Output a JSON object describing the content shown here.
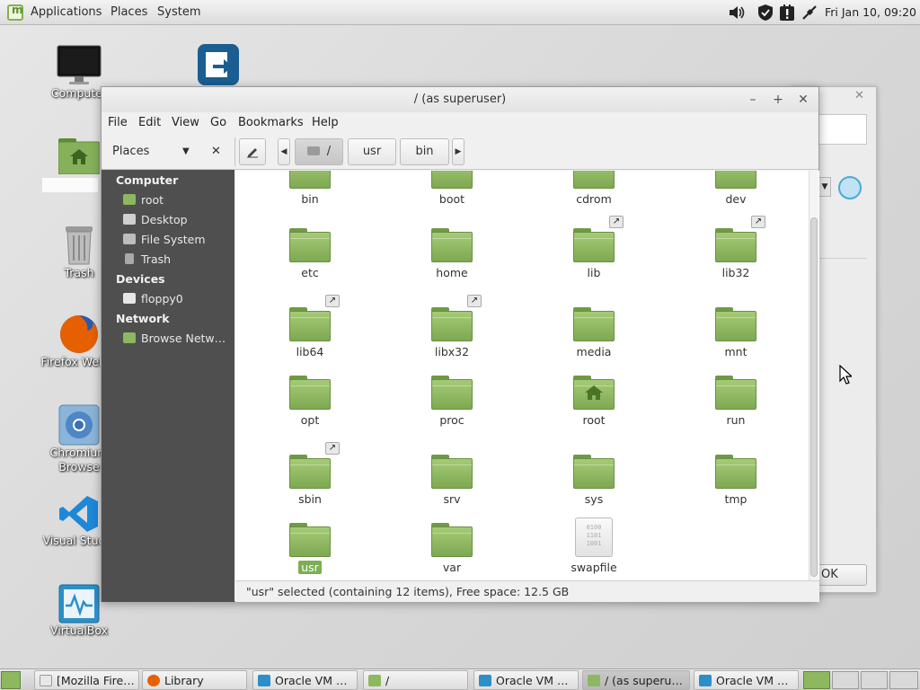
{
  "top_panel": {
    "menu": [
      "Applications",
      "Places",
      "System"
    ],
    "clock": "Fri Jan 10, 09:20",
    "tray_icons": [
      "volume-icon",
      "shield-icon",
      "update-manager-icon",
      "network-icon"
    ]
  },
  "desktop": {
    "icons": [
      {
        "label": "Computer",
        "icon": "monitor-icon"
      },
      {
        "label": "",
        "icon": "app-arrow-icon"
      },
      {
        "label": "",
        "icon": "home-folder-icon"
      },
      {
        "label": "Trash",
        "icon": "trash-icon"
      },
      {
        "label": "Firefox Web B",
        "icon": "firefox-icon"
      },
      {
        "label": "Chromium\nBrowse",
        "icon": "chromium-icon"
      },
      {
        "label": "Visual Studio",
        "icon": "vscode-icon"
      },
      {
        "label": "VirtualBox",
        "icon": "virtualbox-icon"
      }
    ]
  },
  "bg_dialog": {
    "ok_label": "OK"
  },
  "window": {
    "title": "/ (as superuser)",
    "menu": [
      "File",
      "Edit",
      "View",
      "Go",
      "Bookmarks",
      "Help"
    ],
    "places_combo": "Places",
    "breadcrumbs": [
      "/",
      "usr",
      "bin"
    ],
    "sidebar": {
      "sections": [
        {
          "heading": "Computer",
          "items": [
            {
              "label": "root",
              "icon": "home-folder-icon"
            },
            {
              "label": "Desktop",
              "icon": "desktop-icon"
            },
            {
              "label": "File System",
              "icon": "drive-icon"
            },
            {
              "label": "Trash",
              "icon": "trash-icon"
            }
          ]
        },
        {
          "heading": "Devices",
          "items": [
            {
              "label": "floppy0",
              "icon": "floppy-icon"
            }
          ]
        },
        {
          "heading": "Network",
          "items": [
            {
              "label": "Browse Netw…",
              "icon": "network-folder-icon"
            }
          ]
        }
      ]
    },
    "files": [
      {
        "name": "bin",
        "type": "folder",
        "partial": true
      },
      {
        "name": "boot",
        "type": "folder",
        "partial": true
      },
      {
        "name": "cdrom",
        "type": "folder",
        "partial": true
      },
      {
        "name": "dev",
        "type": "folder",
        "partial": true
      },
      {
        "name": "etc",
        "type": "folder"
      },
      {
        "name": "home",
        "type": "folder"
      },
      {
        "name": "lib",
        "type": "folder",
        "link": true
      },
      {
        "name": "lib32",
        "type": "folder",
        "link": true
      },
      {
        "name": "lib64",
        "type": "folder",
        "link": true
      },
      {
        "name": "libx32",
        "type": "folder",
        "link": true
      },
      {
        "name": "media",
        "type": "folder"
      },
      {
        "name": "mnt",
        "type": "folder"
      },
      {
        "name": "opt",
        "type": "folder"
      },
      {
        "name": "proc",
        "type": "folder"
      },
      {
        "name": "root",
        "type": "home-folder"
      },
      {
        "name": "run",
        "type": "folder"
      },
      {
        "name": "sbin",
        "type": "folder",
        "link": true
      },
      {
        "name": "srv",
        "type": "folder"
      },
      {
        "name": "sys",
        "type": "folder"
      },
      {
        "name": "tmp",
        "type": "folder"
      },
      {
        "name": "usr",
        "type": "folder",
        "selected": true
      },
      {
        "name": "var",
        "type": "folder"
      },
      {
        "name": "swapfile",
        "type": "file"
      }
    ],
    "status": "\"usr\" selected (containing 12 items), Free space: 12.5 GB"
  },
  "taskbar": {
    "tasks": [
      {
        "label": "[Mozilla Fire…",
        "icon": "blank-window-icon"
      },
      {
        "label": "Library",
        "icon": "firefox-icon"
      },
      {
        "label": "Oracle VM …",
        "icon": "virtualbox-icon"
      },
      {
        "label": "/",
        "icon": "folder-icon"
      },
      {
        "label": "Oracle VM …",
        "icon": "virtualbox-icon"
      },
      {
        "label": "/ (as superu…",
        "icon": "folder-icon",
        "active": true
      },
      {
        "label": "Oracle VM …",
        "icon": "virtualbox-icon"
      }
    ]
  },
  "colors": {
    "folder_green": "#8db85f",
    "selection": "#7cae53",
    "sidebar_bg": "#4f4f4f"
  }
}
